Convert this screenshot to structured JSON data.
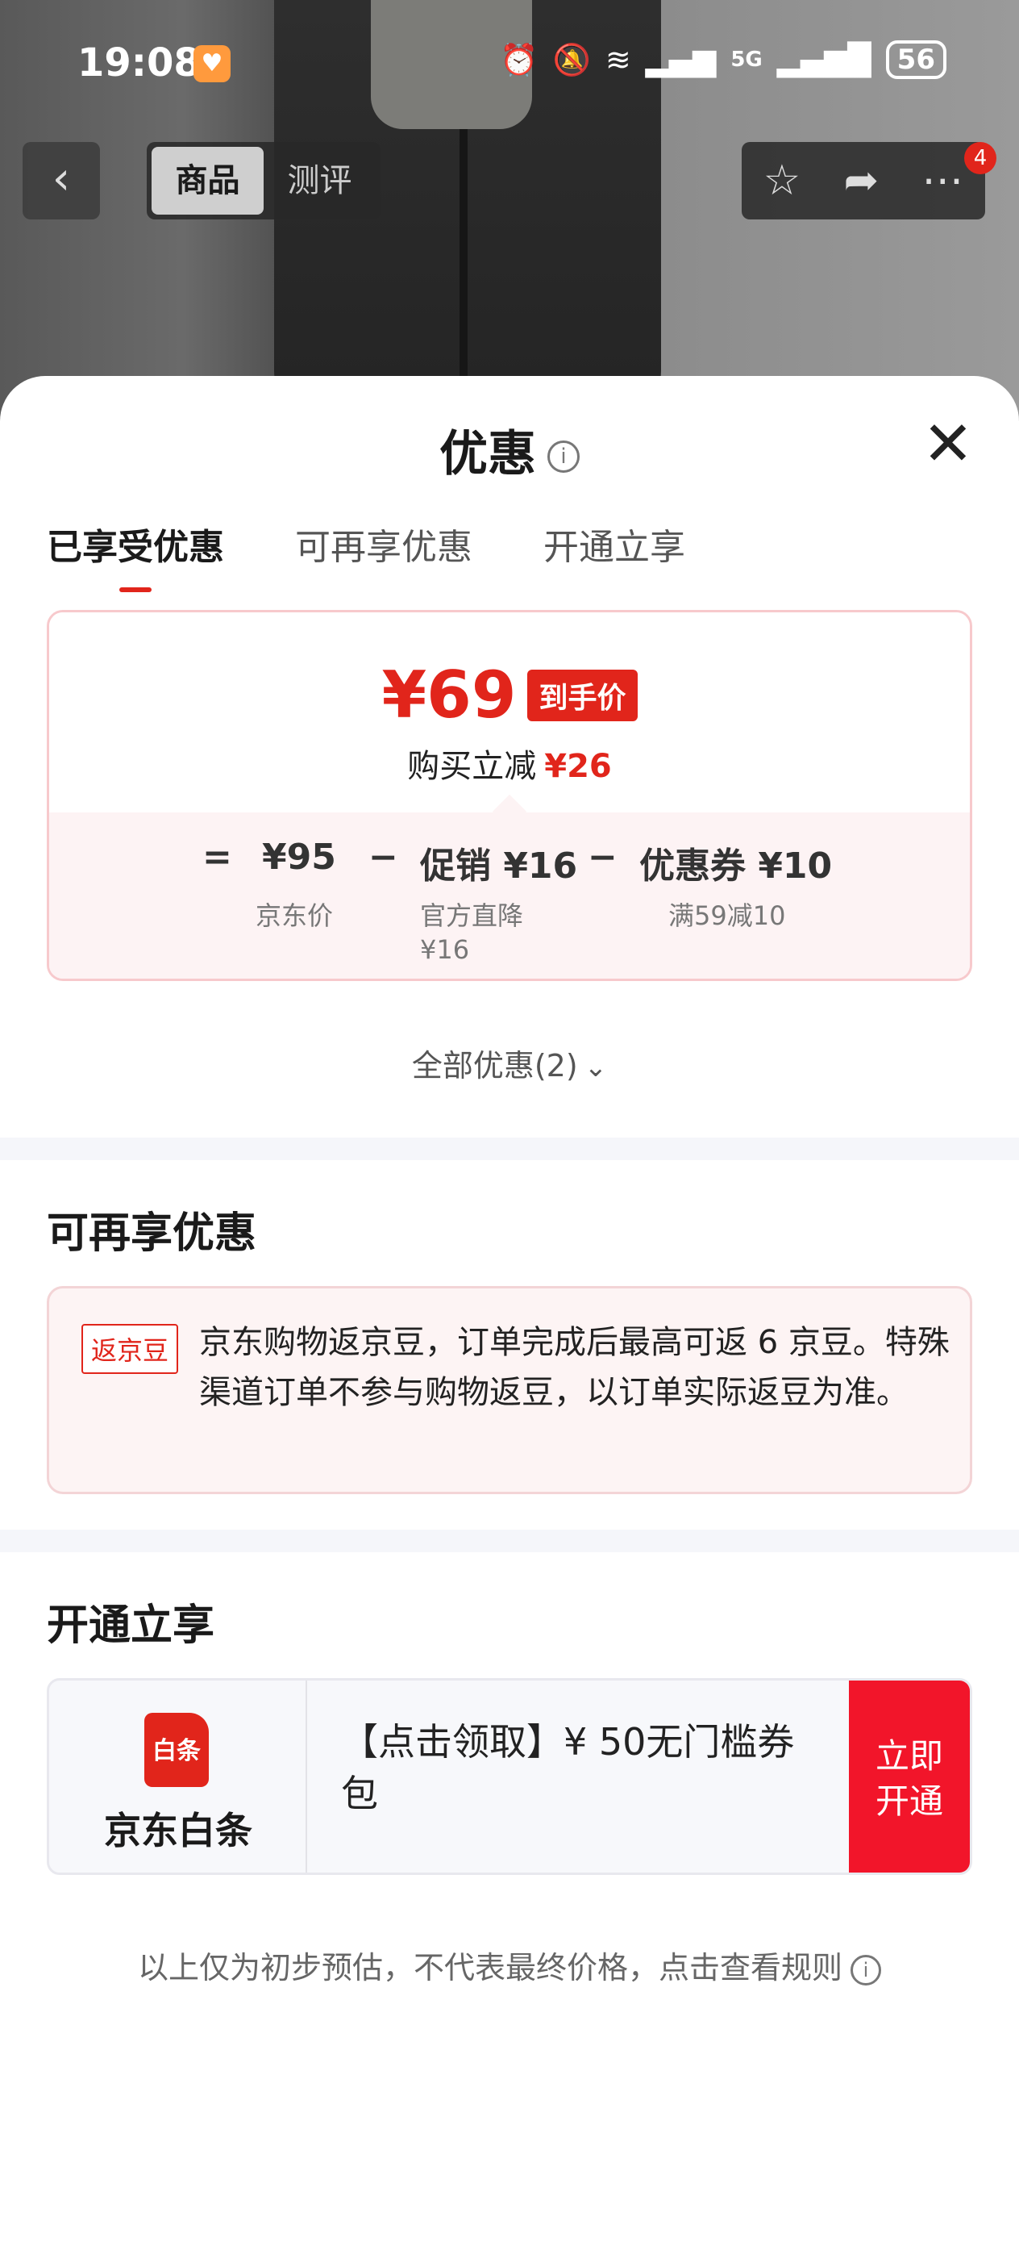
{
  "status_bar": {
    "time": "19:08",
    "battery": "56",
    "network": "5G"
  },
  "nav": {
    "back_icon": "chevron-left-icon",
    "tabs": [
      {
        "label": "商品",
        "active": true
      },
      {
        "label": "测评",
        "active": false
      }
    ],
    "badge_count": "4"
  },
  "sheet": {
    "title": "优惠",
    "tabs": [
      {
        "label": "已享受优惠",
        "active": true
      },
      {
        "label": "可再享优惠",
        "active": false
      },
      {
        "label": "开通立享",
        "active": false
      }
    ],
    "price": {
      "final": "¥69",
      "final_tag": "到手价",
      "reduction_label": "购买立减",
      "reduction_value": "¥26",
      "equals": "=",
      "base_price": "¥95",
      "base_label": "京东价",
      "minus1": "−",
      "promo": "促销 ¥16",
      "promo_sub1": "官方直降",
      "promo_sub2": "¥16",
      "minus2": "−",
      "coupon": "优惠券 ¥10",
      "coupon_sub": "满59减10"
    },
    "all_discounts": "全部优惠(2)",
    "more_section": {
      "title": "可再享优惠",
      "tag": "返京豆",
      "text": "京东购物返京豆，订单完成后最高可返 6 京豆。特殊渠道订单不参与购物返豆，以订单实际返豆为准。"
    },
    "open_section": {
      "title": "开通立享",
      "logo_text": "白条",
      "brand": "京东白条",
      "offer": "【点击领取】¥ 50无门槛券包",
      "button_line1": "立即",
      "button_line2": "开通"
    },
    "footnote": "以上仅为初步预估，不代表最终价格，点击查看规则"
  }
}
